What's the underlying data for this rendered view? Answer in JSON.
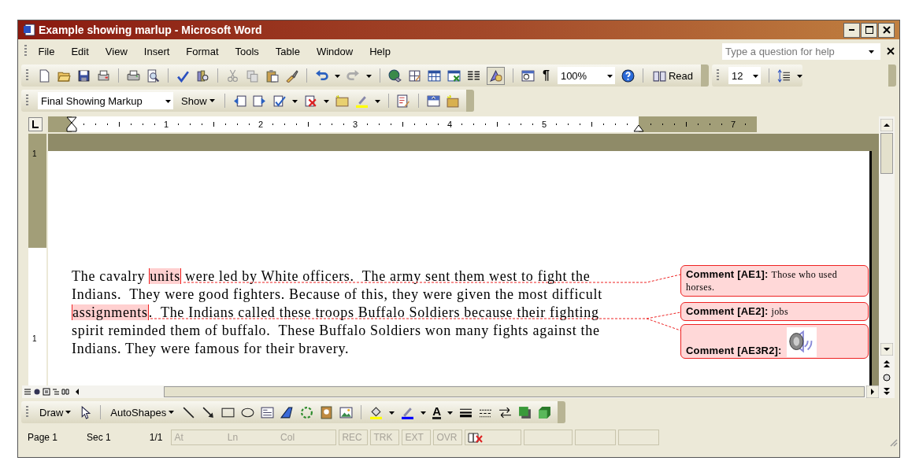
{
  "window": {
    "title": "Example showing marlup - Microsoft Word"
  },
  "menu": [
    "File",
    "Edit",
    "View",
    "Insert",
    "Format",
    "Tools",
    "Table",
    "Window",
    "Help"
  ],
  "help_box": {
    "placeholder": "Type a question for help"
  },
  "toolbar": {
    "pilcrow": "¶",
    "zoom": "100%",
    "read_label": "Read",
    "font_size": "12",
    "drawing_on": true
  },
  "reviewing_toolbar": {
    "display": "Final Showing Markup",
    "show_label": "Show"
  },
  "ruler": {
    "numbers": [
      "1",
      "2",
      "3",
      "4",
      "5",
      "7"
    ],
    "vertical_numbers": [
      "1",
      "1"
    ]
  },
  "document": {
    "paragraph": [
      {
        "kind": "text",
        "text": "The cavalry "
      },
      {
        "kind": "anchor",
        "text": "units"
      },
      {
        "kind": "text",
        "text": " were led by White officers.  The army sent them west to fight the\nIndians.  They were good fighters. Because of this, they were given the most difficult\n"
      },
      {
        "kind": "anchor",
        "text": "assignments"
      },
      {
        "kind": "text",
        "text": ".  The Indians called these troops Buffalo Soldiers because their fighting\nspirit reminded them of buffalo.  These Buffalo Soldiers won many fights against the\nIndians. They were famous for their bravery."
      }
    ],
    "comments": [
      {
        "kind": "text",
        "label": "Comment [AE1]:",
        "text": "Those who used horses."
      },
      {
        "kind": "text",
        "label": "Comment [AE2]:",
        "text": "jobs"
      },
      {
        "kind": "audio",
        "label": "Comment [AE3R2]:"
      }
    ]
  },
  "drawing_toolbar": {
    "draw_label": "Draw",
    "autoshapes_label": "AutoShapes",
    "font_color_glyph": "A"
  },
  "status_bar": {
    "page": "Page 1",
    "section": "Sec 1",
    "pages": "1/1",
    "position": [
      {
        "text": "At",
        "disabled": true
      },
      {
        "text": "Ln",
        "disabled": true
      },
      {
        "text": "Col",
        "disabled": true
      }
    ],
    "modes": [
      {
        "text": "REC",
        "disabled": true
      },
      {
        "text": "TRK",
        "disabled": true
      },
      {
        "text": "EXT",
        "disabled": true
      },
      {
        "text": "OVR",
        "disabled": true
      }
    ]
  }
}
